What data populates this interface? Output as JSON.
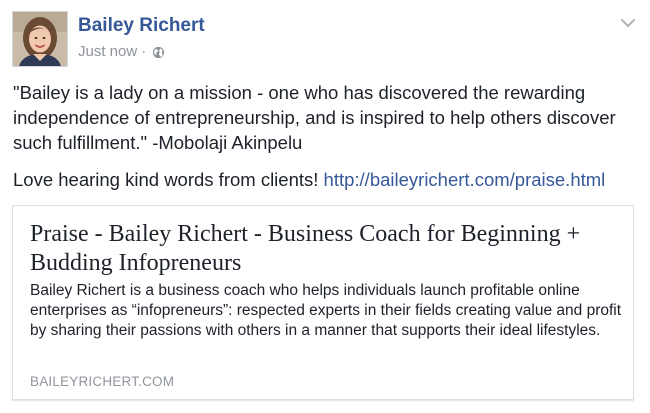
{
  "post": {
    "author": "Bailey Richert",
    "timestamp": "Just now",
    "separator": "·",
    "privacy_icon": "globe-icon",
    "menu_icon": "chevron-down-icon",
    "quote": "\"Bailey is a lady on a mission - one who has discovered the rewarding independence of entrepreneurship, and is inspired to help others discover such fulfillment.\" -Mobolaji Akinpelu",
    "message": "Love hearing kind words from clients!",
    "link_text": "http://baileyrichert.com/praise.html"
  },
  "link_card": {
    "title": "Praise - Bailey Richert - Business Coach for Beginning + Budding Infopreneurs",
    "description": "Bailey Richert is a business coach who helps individuals launch profitable online enterprises as “infopreneurs”: respected experts in their fields creating value and profit by sharing their passions with others in a manner that supports their ideal lifestyles.",
    "domain": "BAILEYRICHERT.COM"
  },
  "colors": {
    "author_link": "#365899",
    "meta_gray": "#90949c",
    "text": "#1d2129",
    "card_border": "#dddfe2"
  }
}
